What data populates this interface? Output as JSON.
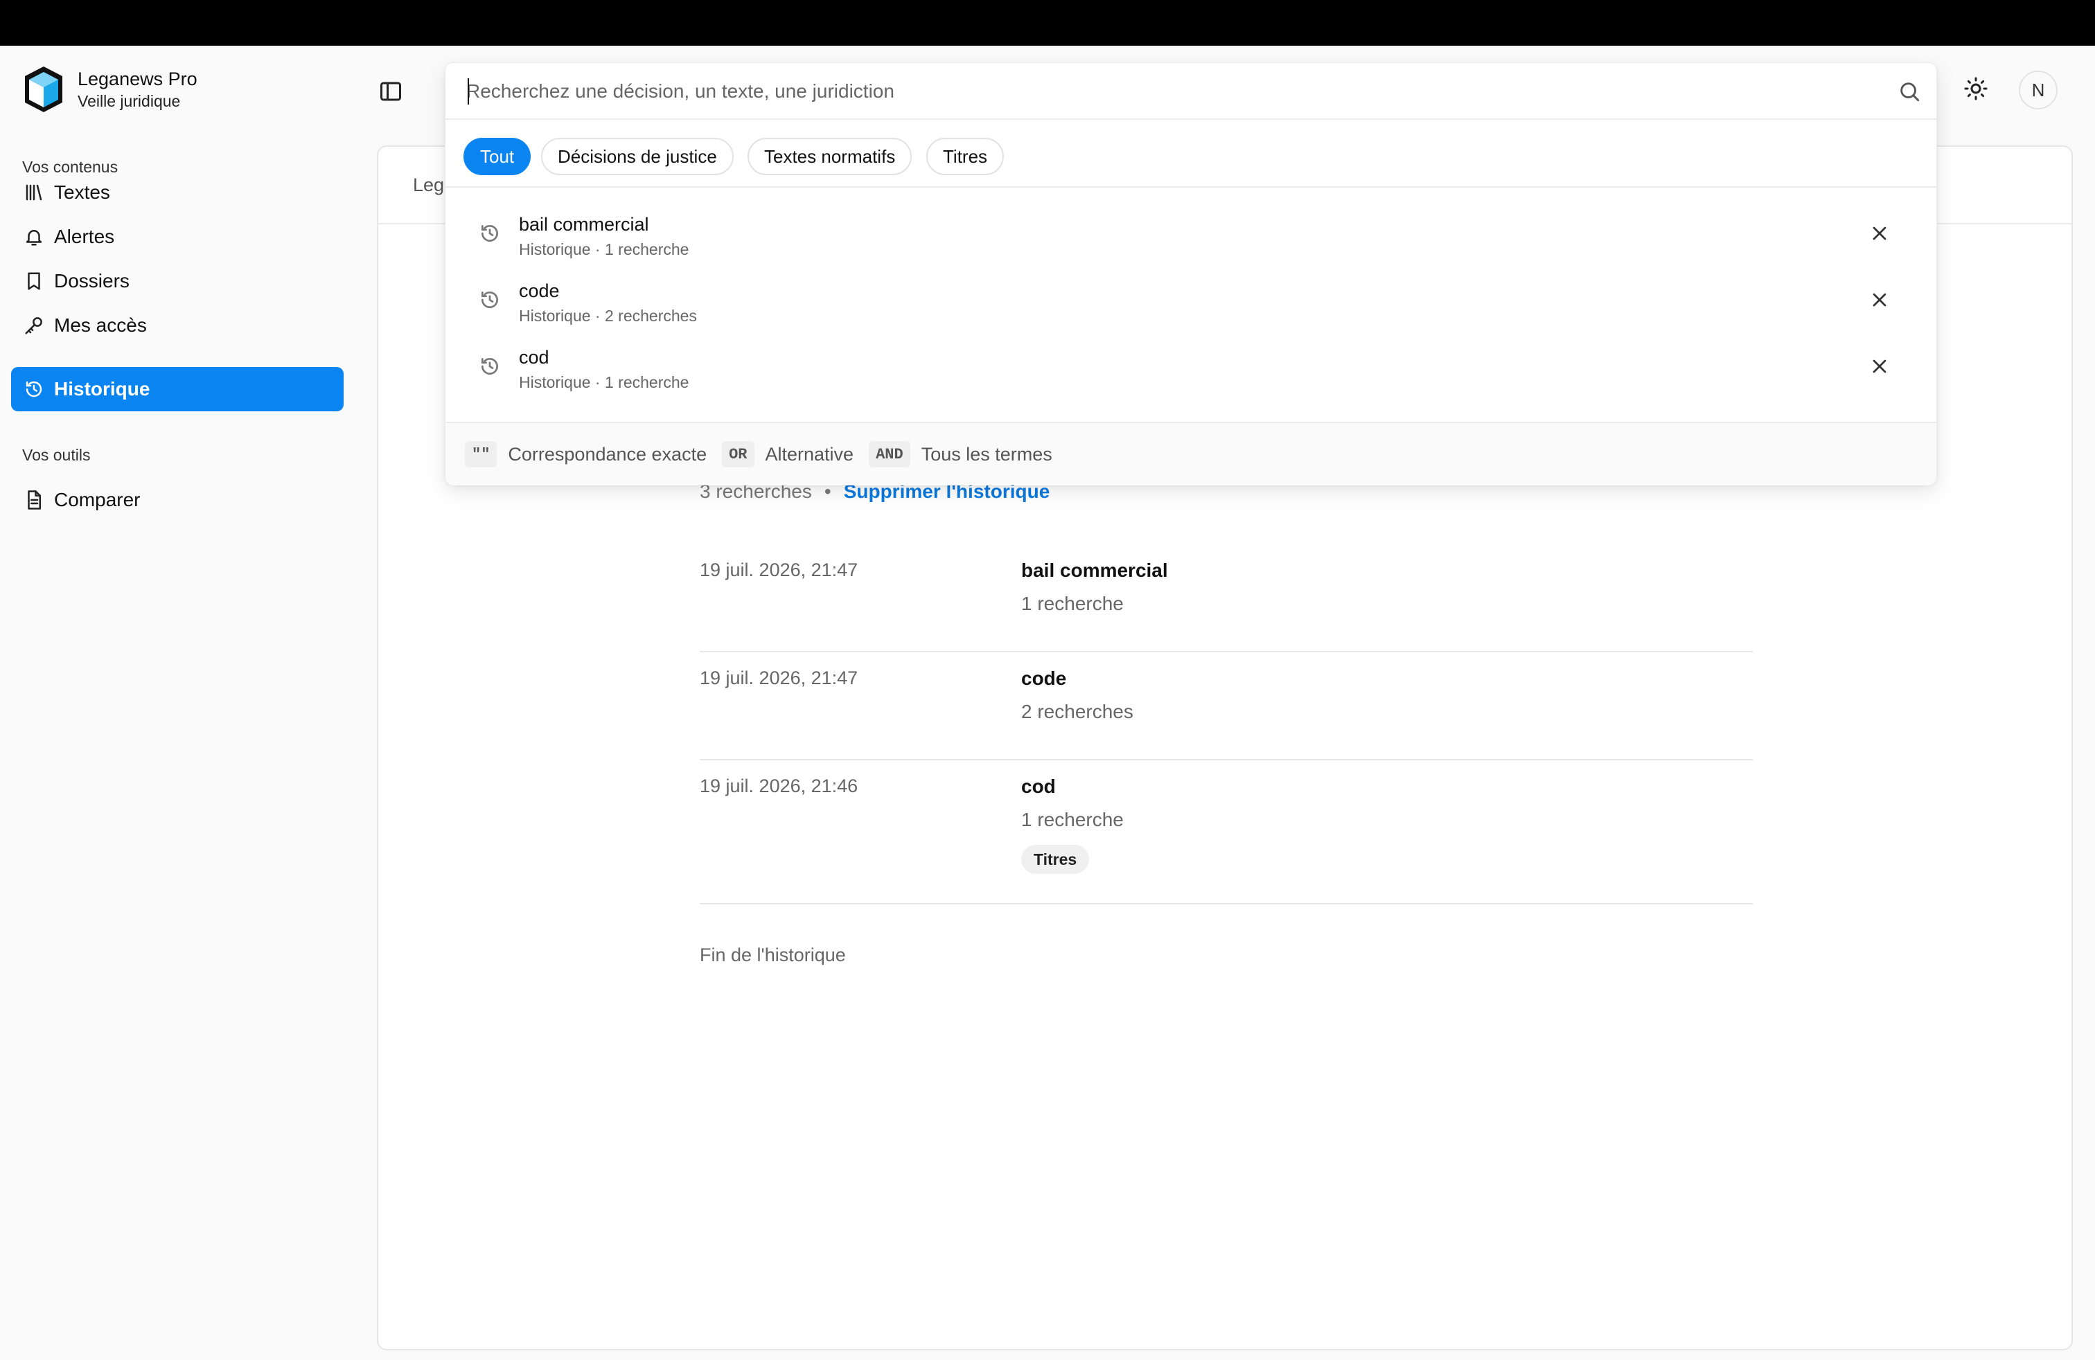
{
  "brand": {
    "name": "Leganews Pro",
    "subtitle": "Veille juridique"
  },
  "sidebar": {
    "section_contents": "Vos contenus",
    "items": [
      {
        "label": "Textes",
        "icon": "library-icon"
      },
      {
        "label": "Alertes",
        "icon": "bell-icon"
      },
      {
        "label": "Dossiers",
        "icon": "bookmark-icon"
      },
      {
        "label": "Mes accès",
        "icon": "key-icon"
      },
      {
        "label": "Historique",
        "icon": "history-icon",
        "active": true
      }
    ],
    "section_tools": "Vos outils",
    "tools": [
      {
        "label": "Comparer",
        "icon": "document-icon"
      }
    ]
  },
  "header": {
    "avatar_initial": "N"
  },
  "search": {
    "placeholder": "Recherchez une décision, un texte, une juridiction",
    "filters": [
      {
        "label": "Tout",
        "active": true
      },
      {
        "label": "Décisions de justice",
        "active": false
      },
      {
        "label": "Textes normatifs",
        "active": false
      },
      {
        "label": "Titres",
        "active": false
      }
    ],
    "suggestions": [
      {
        "title": "bail commercial",
        "meta": "Historique · 1 recherche"
      },
      {
        "title": "code",
        "meta": "Historique · 2 recherches"
      },
      {
        "title": "cod",
        "meta": "Historique · 1 recherche"
      }
    ],
    "hints": [
      {
        "badge": "\"\"",
        "label": "Correspondance exacte"
      },
      {
        "badge": "OR",
        "label": "Alternative"
      },
      {
        "badge": "AND",
        "label": "Tous les termes"
      }
    ]
  },
  "main": {
    "header_title_partial": "Leg",
    "summary_count": "3 recherches",
    "summary_separator": "•",
    "clear_label": "Supprimer l'historique",
    "entries": [
      {
        "date": "19 juil. 2026, 21:47",
        "query": "bail commercial",
        "count": "1 recherche"
      },
      {
        "date": "19 juil. 2026, 21:47",
        "query": "code",
        "count": "2 recherches"
      },
      {
        "date": "19 juil. 2026, 21:46",
        "query": "cod",
        "count": "1 recherche",
        "tag": "Titres"
      }
    ],
    "end_label": "Fin de l'historique"
  },
  "colors": {
    "accent": "#0a84f0",
    "link": "#0a7ae0",
    "topbar": "#000000"
  }
}
